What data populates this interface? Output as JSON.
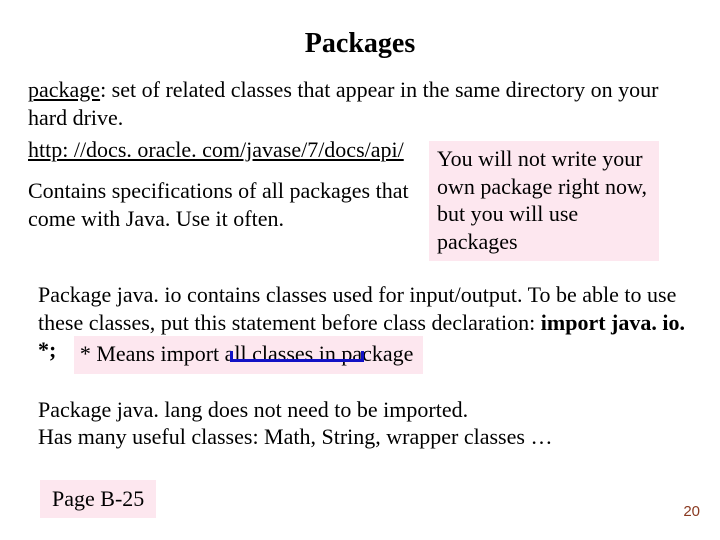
{
  "title": "Packages",
  "definition": {
    "term": "package",
    "text": ": set of related classes that appear in the same directory on your hard drive."
  },
  "link": "http: //docs. oracle. com/javase/7/docs/api/",
  "spec_note": "Contains specifications of all packages that come with Java. Use it often.",
  "right_box": "You will not write your own package right now, but you will use packages",
  "io_para": {
    "lead": "Package java. io contains classes used for input/output. To be able to use these classes, put this statement before class declaration:  ",
    "import_stmt": "import java. io. *;"
  },
  "import_box": "* Means import all classes in package",
  "lang_para": "Package java. lang does not need to be imported.\nHas many useful classes: Math, String, wrapper classes …",
  "page_ref": "Page B-25",
  "page_num": "20"
}
